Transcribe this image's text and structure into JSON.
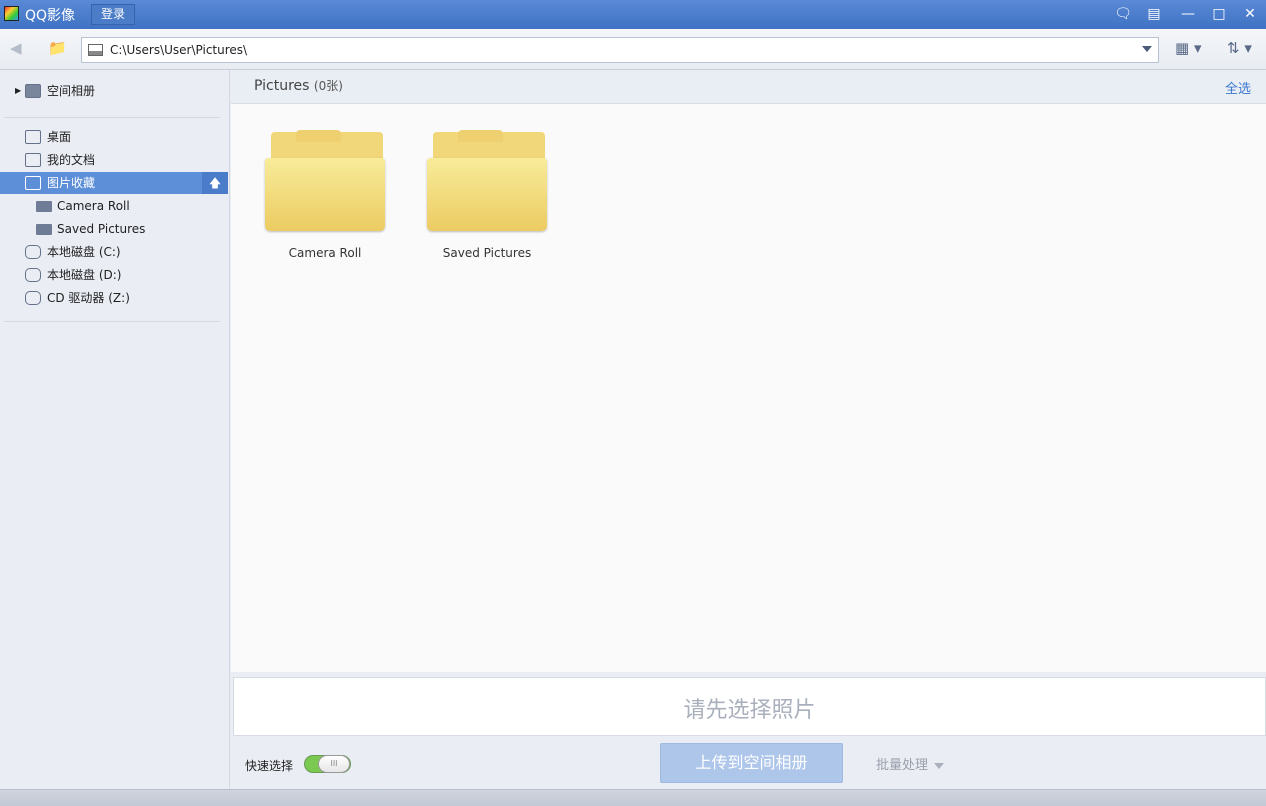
{
  "app": {
    "title": "QQ影像",
    "login_label": "登录"
  },
  "window": {
    "icons": [
      "feedback-icon",
      "menu-icon",
      "minimize-icon",
      "maximize-icon",
      "close-icon"
    ]
  },
  "toolbar": {
    "address": "C:\\Users\\User\\Pictures\\",
    "view_icon": "grid-view-icon",
    "sort_icon": "sort-icon"
  },
  "sidebar": {
    "qzone": "空间相册",
    "items": [
      {
        "label": "桌面",
        "icon": "desktop-icon"
      },
      {
        "label": "我的文档",
        "icon": "documents-icon"
      },
      {
        "label": "图片收藏",
        "icon": "pictures-icon",
        "selected": true
      },
      {
        "label": "Camera Roll",
        "icon": "folder-icon"
      },
      {
        "label": "Saved Pictures",
        "icon": "folder-icon"
      },
      {
        "label": "本地磁盘 (C:)",
        "icon": "drive-icon"
      },
      {
        "label": "本地磁盘 (D:)",
        "icon": "drive-icon"
      },
      {
        "label": "CD 驱动器 (Z:)",
        "icon": "cd-drive-icon"
      }
    ]
  },
  "main": {
    "title": "Pictures",
    "count": "(0张)",
    "select_all": "全选",
    "folders": [
      {
        "name": "Camera Roll"
      },
      {
        "name": "Saved Pictures"
      }
    ]
  },
  "bottom": {
    "hint": "请先选择照片",
    "quick_select": "快速选择",
    "quick_select_on": true,
    "upload_label": "上传到空间相册",
    "batch_label": "批量处理"
  },
  "colors": {
    "accent": "#3f72c4",
    "selection": "#5d8fd8",
    "toggle_on": "#7bc950"
  }
}
